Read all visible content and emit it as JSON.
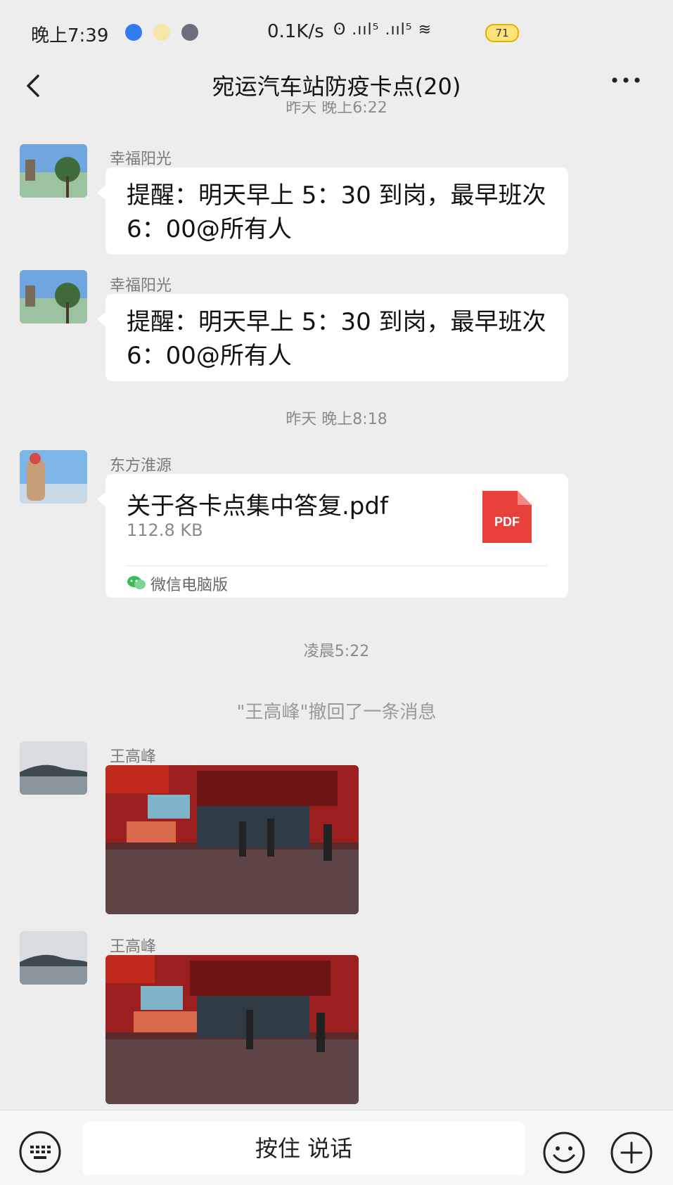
{
  "status_bar": {
    "time": "晚上7:39",
    "net_speed": "0.1K/s",
    "signal_icons": "ʘ .ııl⁵ .ııl⁵ ≋",
    "battery": "71"
  },
  "nav": {
    "title": "宛运汽车站防疫卡点(20)"
  },
  "timestamps": {
    "partial": "昨天 晚上6:22",
    "t1": "昨天 晚上8:18",
    "t2": "凌晨5:22"
  },
  "messages": [
    {
      "sender": "幸福阳光",
      "text": "提醒：明天早上 5：30 到岗，最早班次 6：00@所有人"
    },
    {
      "sender": "幸福阳光",
      "text": "提醒：明天早上 5：30 到岗，最早班次 6：00@所有人"
    },
    {
      "sender": "东方淮源",
      "file_name": "关于各卡点集中答复.pdf",
      "file_size": "112.8 KB",
      "file_badge": "PDF",
      "source": "微信电脑版"
    },
    {
      "sender": "王高峰"
    },
    {
      "sender": "王高峰"
    }
  ],
  "recall_notice": "\"王高峰\"撤回了一条消息",
  "bottom": {
    "voice_label": "按住 说话"
  },
  "colors": {
    "background": "#ededed",
    "bubble": "#ffffff",
    "pdf_red": "#e8403a",
    "wechat_green": "#3cb95a"
  },
  "icons": [
    "back-icon",
    "more-icon",
    "pdf-file-icon",
    "wechat-pc-icon",
    "keyboard-icon",
    "emoji-icon",
    "plus-icon"
  ]
}
